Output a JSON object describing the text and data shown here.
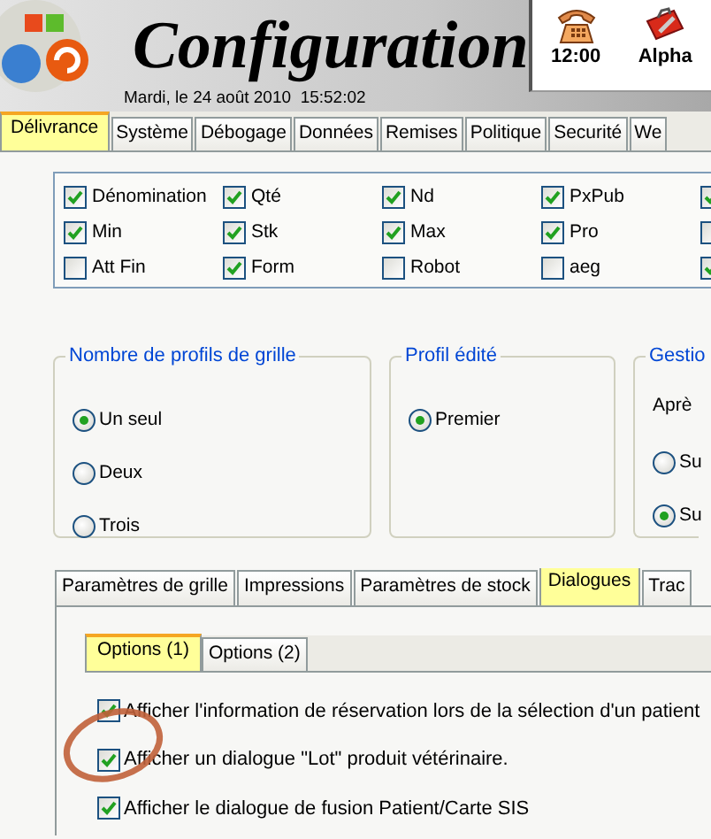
{
  "header": {
    "title": "Configuration",
    "datetime": "Mardi, le 24 août 2010  15:52:02",
    "status": [
      {
        "kind": "phone",
        "label": "12:00"
      },
      {
        "kind": "toolbox",
        "label": "Alpha"
      }
    ]
  },
  "tabs": [
    {
      "label": "Délivrance",
      "selected": true
    },
    {
      "label": "Système",
      "selected": false
    },
    {
      "label": "Débogage",
      "selected": false
    },
    {
      "label": "Données",
      "selected": false
    },
    {
      "label": "Remises",
      "selected": false
    },
    {
      "label": "Politique",
      "selected": false
    },
    {
      "label": "Securité",
      "selected": false
    },
    {
      "label": "We",
      "selected": false
    }
  ],
  "checkbox_rows": [
    [
      {
        "label": "Dénomination",
        "checked": true
      },
      {
        "label": "Qté",
        "checked": true
      },
      {
        "label": "Nd",
        "checked": true
      },
      {
        "label": "PxPub",
        "checked": true
      },
      {
        "checked": true
      }
    ],
    [
      {
        "label": "Min",
        "checked": true
      },
      {
        "label": "Stk",
        "checked": true
      },
      {
        "label": "Max",
        "checked": true
      },
      {
        "label": "Pro",
        "checked": true
      },
      {
        "checked": false
      }
    ],
    [
      {
        "label": "Att Fin",
        "checked": false
      },
      {
        "label": "Form",
        "checked": true
      },
      {
        "label": "Robot",
        "checked": false
      },
      {
        "label": "aeg",
        "checked": false
      },
      {
        "checked": true
      }
    ]
  ],
  "groups": [
    {
      "title": "Nombre de profils de grille",
      "options": [
        {
          "label": "Un seul",
          "selected": true
        },
        {
          "label": "Deux",
          "selected": false
        },
        {
          "label": "Trois",
          "selected": false
        }
      ]
    },
    {
      "title": "Profil édité",
      "options": [
        {
          "label": "Premier",
          "selected": true
        }
      ]
    },
    {
      "title": "Gestio",
      "text": "Aprè",
      "options": [
        {
          "label": "Su",
          "selected": false
        },
        {
          "label": "Su",
          "selected": true
        }
      ]
    }
  ],
  "sub_tabs": [
    {
      "label": "Paramètres de grille",
      "selected": false
    },
    {
      "label": "Impressions",
      "selected": false
    },
    {
      "label": "Paramètres de stock",
      "selected": false
    },
    {
      "label": "Dialogues",
      "selected": true
    },
    {
      "label": "Trac",
      "selected": false
    }
  ],
  "inner_tabs": [
    {
      "label": "Options (1)",
      "selected": true
    },
    {
      "label": "Options (2)",
      "selected": false
    }
  ],
  "dialog_options": [
    {
      "label": "Afficher l'information de réservation lors de la sélection d'un patient",
      "checked": true
    },
    {
      "label": "Afficher un dialogue \"Lot\" produit vétérinaire.",
      "checked": true
    },
    {
      "label": "Afficher le dialogue de fusion Patient/Carte SIS",
      "checked": true
    }
  ]
}
